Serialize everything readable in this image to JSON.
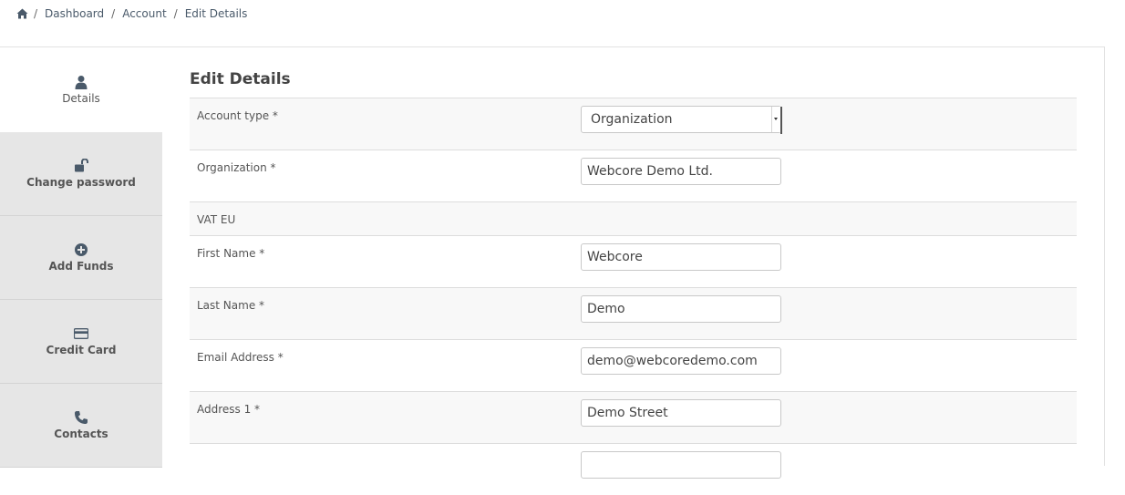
{
  "breadcrumb": {
    "items": [
      "Dashboard",
      "Account"
    ],
    "current": "Edit Details",
    "separator": "/"
  },
  "sidebar": {
    "items": [
      {
        "label": "Details",
        "icon": "user-icon",
        "active": true
      },
      {
        "label": "Change password",
        "icon": "unlock-icon",
        "active": false
      },
      {
        "label": "Add Funds",
        "icon": "plus-circle-icon",
        "active": false
      },
      {
        "label": "Credit Card",
        "icon": "credit-card-icon",
        "active": false
      },
      {
        "label": "Contacts",
        "icon": "phone-icon",
        "active": false
      }
    ]
  },
  "form": {
    "title": "Edit Details",
    "fields": {
      "account_type": {
        "label": "Account type *",
        "value": "Organization"
      },
      "organization": {
        "label": "Organization *",
        "value": "Webcore Demo Ltd."
      },
      "vat_eu": {
        "label": "VAT EU"
      },
      "first_name": {
        "label": "First Name *",
        "value": "Webcore"
      },
      "last_name": {
        "label": "Last Name *",
        "value": "Demo"
      },
      "email": {
        "label": "Email Address *",
        "value": "demo@webcoredemo.com"
      },
      "address1": {
        "label": "Address 1 *",
        "value": "Demo Street"
      }
    }
  },
  "colors": {
    "sidebar_bg": "#e6e6e6",
    "row_alt_bg": "#f8f8f8",
    "border": "#dddddd"
  }
}
